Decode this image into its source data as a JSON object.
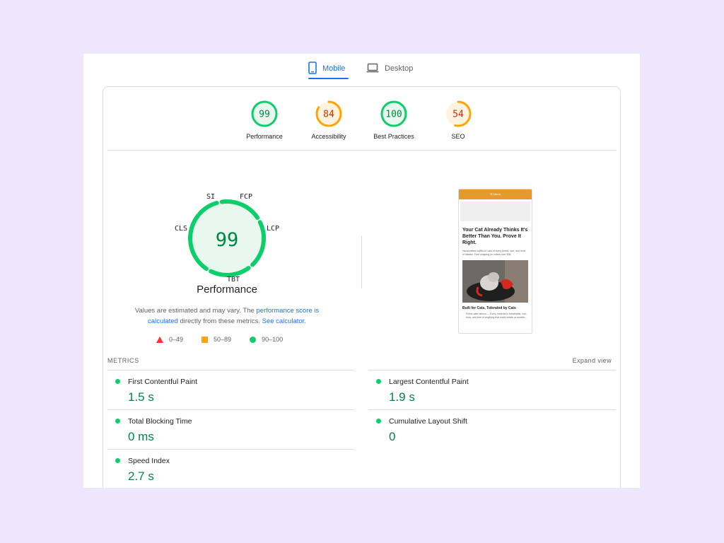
{
  "tabs": [
    {
      "label": "Mobile",
      "icon": "smartphone-icon",
      "active": true
    },
    {
      "label": "Desktop",
      "icon": "laptop-icon",
      "active": false
    }
  ],
  "scores": [
    {
      "label": "Performance",
      "value": "99",
      "fraction": 0.99,
      "color": "#0cce6b",
      "bg": "#e8f8ee",
      "text_color": "#018642"
    },
    {
      "label": "Accessibility",
      "value": "84",
      "fraction": 0.84,
      "color": "#ffa400",
      "bg": "#fff3e0",
      "text_color": "#c33300"
    },
    {
      "label": "Best Practices",
      "value": "100",
      "fraction": 1.0,
      "color": "#0cce6b",
      "bg": "#e8f8ee",
      "text_color": "#018642"
    },
    {
      "label": "SEO",
      "value": "54",
      "fraction": 0.54,
      "color": "#ffa400",
      "bg": "#fff3e0",
      "text_color": "#c33300"
    }
  ],
  "gauge": {
    "score": "99",
    "title": "Performance",
    "tags": {
      "si": "SI",
      "fcp": "FCP",
      "cls": "CLS",
      "lcp": "LCP",
      "tbt": "TBT"
    },
    "color": "#0cce6b",
    "bg": "#e8f8ee",
    "text_color": "#018642"
  },
  "description": {
    "before": "Values are estimated and may vary. The ",
    "link1": "performance score is calculated",
    "middle": " directly from these metrics. ",
    "link2": "See calculator."
  },
  "legend": [
    {
      "range": "0–49",
      "shape": "triangle",
      "color": "#ff3333"
    },
    {
      "range": "50–89",
      "shape": "square",
      "color": "#ffa400"
    },
    {
      "range": "90–100",
      "shape": "circle",
      "color": "#0cce6b"
    }
  ],
  "preview": {
    "bar": "☰ Menu",
    "heading": "Your Cat Already Thinks It's Better Than You. Prove It Right.",
    "paragraph": "Handcrafted outfits for cats of every breed, size, and level of disdain. Free shipping on orders over $35.",
    "subheading": "Built for Cats, Tolerated by Cats",
    "list_item": "Feline-safe fabrics — Every material is breathable, non-toxic, and free of anything that could irritate or scratch..."
  },
  "metrics": {
    "heading": "METRICS",
    "expand": "Expand view",
    "items": [
      {
        "name": "First Contentful Paint",
        "value": "1.5 s"
      },
      {
        "name": "Largest Contentful Paint",
        "value": "1.9 s"
      },
      {
        "name": "Total Blocking Time",
        "value": "0 ms"
      },
      {
        "name": "Cumulative Layout Shift",
        "value": "0"
      },
      {
        "name": "Speed Index",
        "value": "2.7 s"
      }
    ]
  }
}
